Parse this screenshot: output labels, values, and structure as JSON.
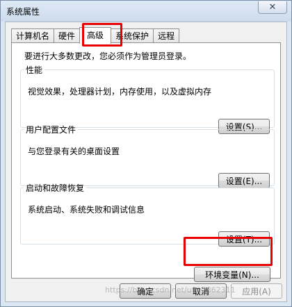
{
  "window": {
    "title": "系统属性",
    "close_glyph": "✕"
  },
  "tabs": [
    {
      "label": "计算机名",
      "active": false
    },
    {
      "label": "硬件",
      "active": false
    },
    {
      "label": "高级",
      "active": true
    },
    {
      "label": "系统保护",
      "active": false
    },
    {
      "label": "远程",
      "active": false
    }
  ],
  "advanced": {
    "notice": "要进行大多数更改，您必须作为管理员登录。",
    "performance": {
      "title": "性能",
      "description": "视觉效果，处理器计划，内存使用，以及虚拟内存",
      "settings_button": "设置(S)..."
    },
    "user_profiles": {
      "title": "用户配置文件",
      "description": "与您登录有关的桌面设置",
      "settings_button": "设置(E)..."
    },
    "startup_recovery": {
      "title": "启动和故障恢复",
      "description": "系统启动、系统失败和调试信息",
      "settings_button": "设置(T)..."
    },
    "env_button": "环境变量(N)..."
  },
  "footer": {
    "ok": "确定",
    "cancel": "取消",
    "apply": "应用(A)"
  },
  "watermark": "https://blog.csdn.net/u012862311",
  "colors": {
    "highlight_red": "#e60000",
    "title_bar": "#dbe6f3"
  }
}
